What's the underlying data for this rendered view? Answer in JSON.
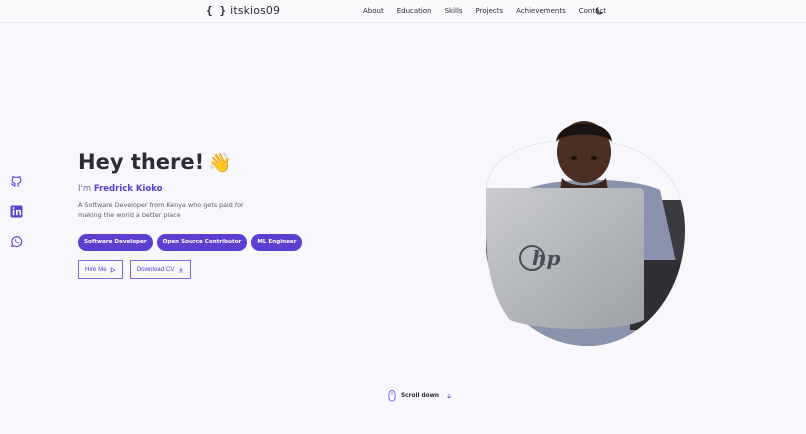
{
  "header": {
    "logo_braces": "{ }",
    "logo_name": "itskios09",
    "nav": [
      "About",
      "Education",
      "Skills",
      "Projects",
      "Achievements",
      "Contact"
    ]
  },
  "social": [
    "github-icon",
    "linkedin-icon",
    "whatsapp-icon"
  ],
  "hero": {
    "title": "Hey there!",
    "wave": "👋",
    "name_prefix": "I'm",
    "name": "Fredrick Kioko",
    "description": "A Software Developer from Kenya who gets paid for making the world a better place",
    "tags": [
      "Software Developer",
      "Open Source Contributor",
      "ML Engineer"
    ],
    "hire_label": "Hire Me",
    "download_label": "Download CV"
  },
  "laptop_brand": "hp",
  "scroll_label": "Scroll down",
  "colors": {
    "accent": "#5b3fd1",
    "background": "#f8f7fb",
    "text": "#2c2c38"
  }
}
